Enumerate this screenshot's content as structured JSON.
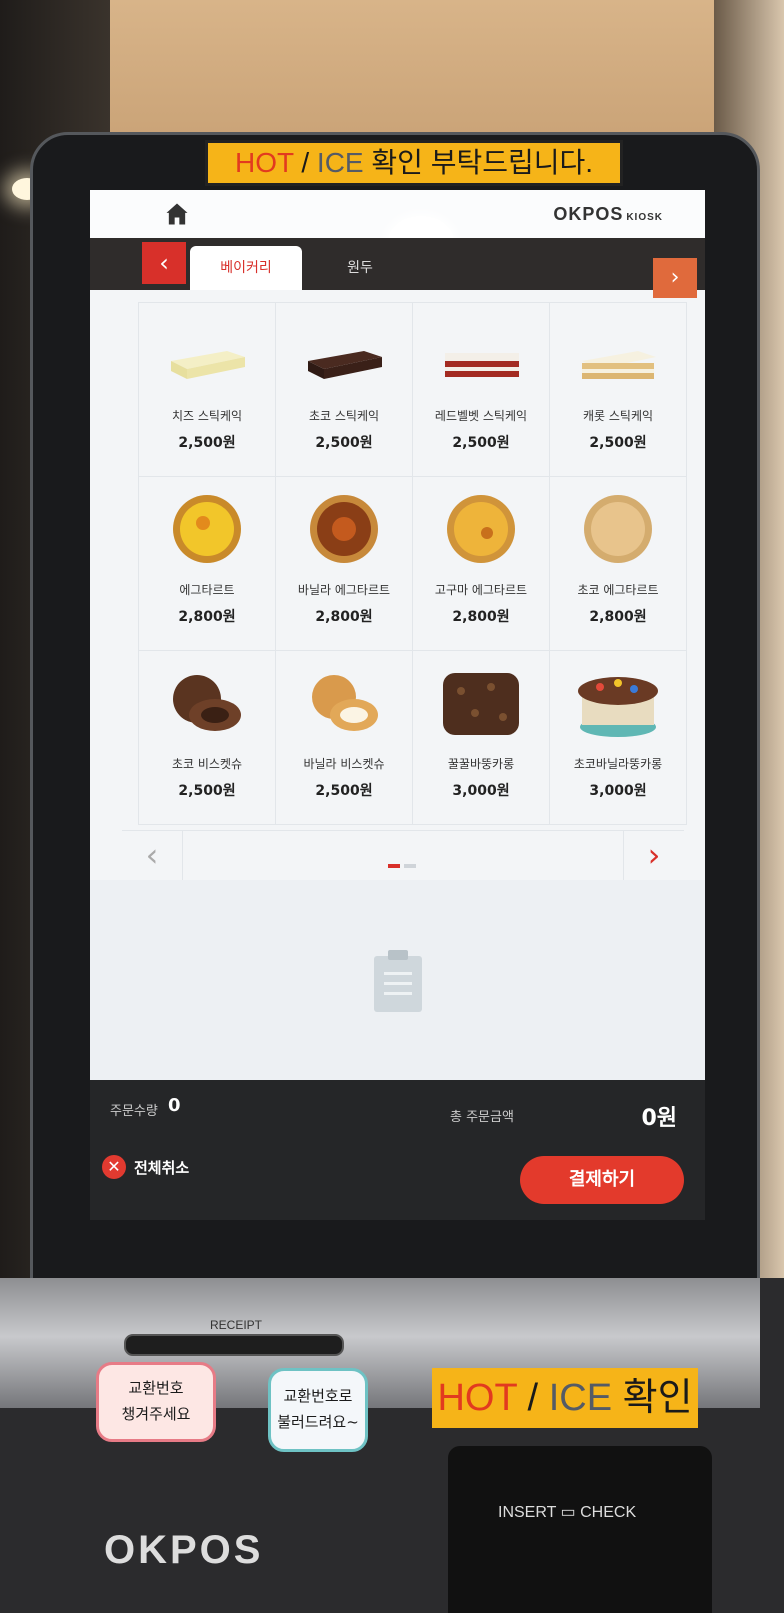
{
  "banner": {
    "hot": "HOT",
    "slash": " / ",
    "ice": "ICE",
    "rest": " 확인 부탁드립니다."
  },
  "header": {
    "brand": "OKPOS",
    "brand_sub": "KIOSK"
  },
  "tabs": [
    {
      "label": "베이커리",
      "active": true
    },
    {
      "label": "원두",
      "active": false
    }
  ],
  "menu": [
    {
      "name": "치즈 스틱케익",
      "price": "2,500원",
      "icon": "cheese-stick-cake"
    },
    {
      "name": "초코 스틱케익",
      "price": "2,500원",
      "icon": "choco-stick-cake"
    },
    {
      "name": "레드벨벳 스틱케익",
      "price": "2,500원",
      "icon": "redvelvet-stick-cake"
    },
    {
      "name": "캐롯 스틱케익",
      "price": "2,500원",
      "icon": "carrot-stick-cake"
    },
    {
      "name": "에그타르트",
      "price": "2,800원",
      "icon": "egg-tart"
    },
    {
      "name": "바닐라 에그타르트",
      "price": "2,800원",
      "icon": "vanilla-egg-tart"
    },
    {
      "name": "고구마 에그타르트",
      "price": "2,800원",
      "icon": "sweet-potato-egg-tart"
    },
    {
      "name": "초코 에그타르트",
      "price": "2,800원",
      "icon": "choco-egg-tart"
    },
    {
      "name": "초코 비스켓슈",
      "price": "2,500원",
      "icon": "choco-biscuit-choux"
    },
    {
      "name": "바닐라 비스켓슈",
      "price": "2,500원",
      "icon": "vanilla-biscuit-choux"
    },
    {
      "name": "꿀꿀바뚱카롱",
      "price": "3,000원",
      "icon": "ggulggul-macaron"
    },
    {
      "name": "초코바닐라뚱카롱",
      "price": "3,000원",
      "icon": "choco-vanilla-macaron"
    }
  ],
  "pagination": {
    "pages": 2,
    "current": 1
  },
  "summary": {
    "qty_label": "주문수량",
    "qty_value": "0",
    "total_label": "총 주문금액",
    "total_value": "0원"
  },
  "actions": {
    "cancel_all": "전체취소",
    "pay": "결제하기"
  },
  "device": {
    "receipt": "RECEIPT",
    "note1": "교환번호\n챙겨주세요",
    "note2": "교환번호로\n불러드려요~",
    "banner2_hot": "HOT",
    "banner2_slash": " / ",
    "banner2_ice": "ICE",
    "banner2_rest": " 확인",
    "card_insert": "INSERT",
    "card_check": "CHECK",
    "logo": "OKPOS"
  }
}
